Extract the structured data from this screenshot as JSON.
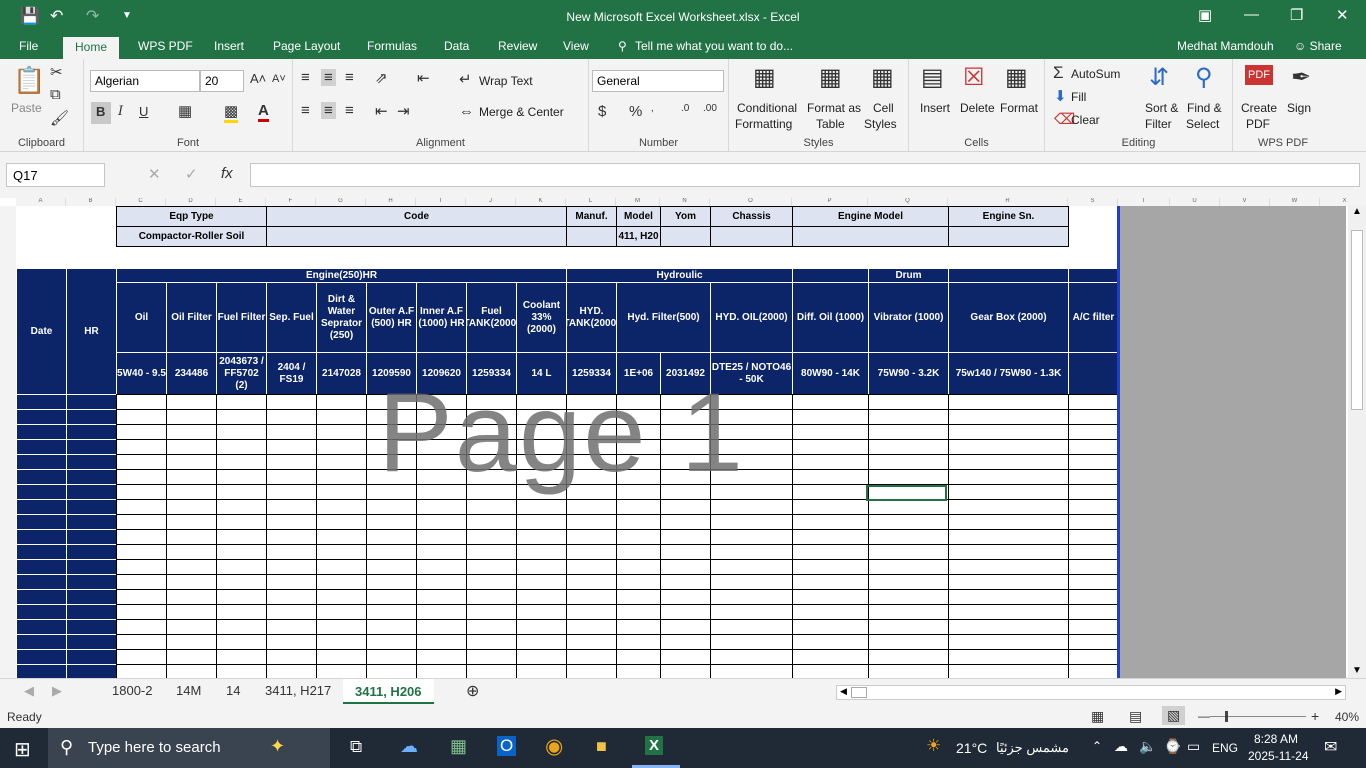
{
  "window": {
    "title": "New Microsoft Excel Worksheet.xlsx - Excel",
    "user": "Medhat Mamdouh",
    "share": "Share"
  },
  "menu_tabs": [
    "File",
    "Home",
    "WPS PDF",
    "Insert",
    "Page Layout",
    "Formulas",
    "Data",
    "Review",
    "View"
  ],
  "tell_me": "Tell me what you want to do...",
  "ribbon": {
    "clipboard": {
      "paste": "Paste",
      "label": "Clipboard"
    },
    "font": {
      "name": "Algerian",
      "size": "20",
      "label": "Font"
    },
    "alignment": {
      "wrap": "Wrap Text",
      "merge": "Merge & Center",
      "label": "Alignment"
    },
    "number": {
      "format": "General",
      "label": "Number"
    },
    "styles": {
      "cond": "Conditional",
      "cond2": "Formatting",
      "fmt": "Format as",
      "fmt2": "Table",
      "cell": "Cell",
      "cell2": "Styles",
      "label": "Styles"
    },
    "cells": {
      "insert": "Insert",
      "delete": "Delete",
      "format": "Format",
      "label": "Cells"
    },
    "editing": {
      "autosum": "AutoSum",
      "fill": "Fill",
      "clear": "Clear",
      "sort": "Sort &",
      "sort2": "Filter",
      "find": "Find &",
      "find2": "Select",
      "label": "Editing"
    },
    "wps": {
      "create": "Create",
      "create2": "PDF",
      "sign": "Sign",
      "label": "WPS PDF"
    }
  },
  "namebox": "Q17",
  "columns": [
    "A",
    "B",
    "C",
    "D",
    "E",
    "F",
    "G",
    "H",
    "I",
    "J",
    "K",
    "L",
    "M",
    "N",
    "O",
    "P",
    "Q",
    "R",
    "S",
    "T",
    "U",
    "V",
    "W",
    "X"
  ],
  "sheet": {
    "eqp_type": "Eqp Type",
    "code": "Code",
    "manuf": "Manuf.",
    "model": "Model",
    "yom": "Yom",
    "chassis": "Chassis",
    "engine_model": "Engine Model",
    "engine_sn": "Engine Sn.",
    "eqp_value": "Compactor-Roller Soil",
    "model_value": "411, H20",
    "date": "Date",
    "hr": "HR",
    "engine_group": "Engine(250)HR",
    "hydro_group": "Hydroulic",
    "drum_group": "Drum",
    "headers": [
      "Oil",
      "Oil Filter",
      "Fuel Filter",
      "Sep. Fuel",
      "Dirt & Water Seprator (250)",
      "Outer A.F (500) HR",
      "Inner A.F (1000) HR",
      "Fuel TANK(2000)",
      "Coolant 33% (2000)",
      "HYD. TANK(2000)",
      "Hyd. Filter(500)",
      "HYD. OIL(2000)",
      "Diff. Oil (1000)",
      "Vibrator (1000)",
      "Gear Box (2000)",
      "A/C filter"
    ],
    "parts": [
      "5W40 - 9.5",
      "234486",
      "2043673 / FF5702 (2)",
      "2404 / FS19",
      "2147028",
      "1209590",
      "1209620",
      "1259334",
      "14 L",
      "1259334",
      "1E+06",
      "2031492",
      "DTE25 / NOTO46 - 50K",
      "80W90 - 14K",
      "75W90 - 3.2K",
      "75w140 / 75W90 - 1.3K"
    ],
    "watermark": "Page 1"
  },
  "sheet_tabs": [
    "1800-2",
    "14M",
    "14",
    "3411, H217",
    "3411, H206"
  ],
  "status": {
    "ready": "Ready",
    "zoom": "40%"
  },
  "taskbar": {
    "search": "Type here to search",
    "weather": "21°C",
    "weather_text": "مشمس جزئيًا",
    "lang": "ENG",
    "time": "8:28 AM",
    "date": "2025-11-24"
  }
}
